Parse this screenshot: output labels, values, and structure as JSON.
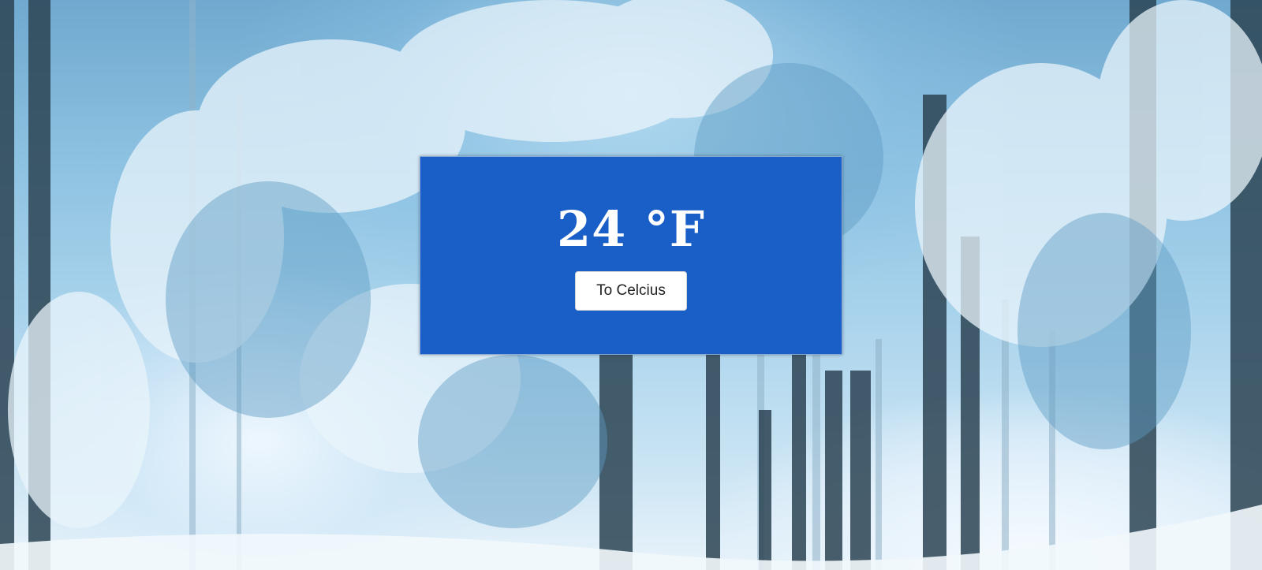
{
  "weather": {
    "temperature": "24",
    "unit": "°F",
    "toggle_label": "To Celcius"
  },
  "colors": {
    "card_background": "#1a5fc8",
    "button_background": "#ffffff",
    "text_on_card": "#ffffff"
  }
}
